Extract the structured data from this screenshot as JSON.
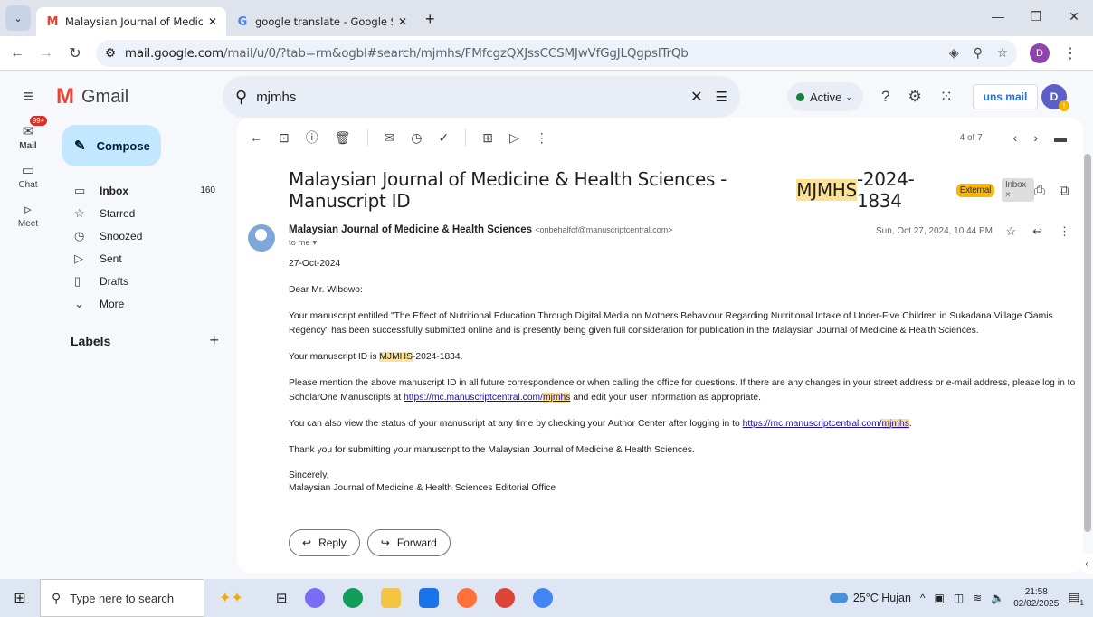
{
  "browser": {
    "tabs": [
      {
        "title": "Malaysian Journal of Medicine (",
        "icon": "gmail-icon",
        "active": true
      },
      {
        "title": "google translate - Google Searc",
        "icon": "google-icon",
        "active": false
      }
    ],
    "url_host": "mail.google.com",
    "url_path": "/mail/u/0/?tab=rm&ogbl#search/mjmhs/FMfcgzQXJssCCSMJwVfGgJLQgpslTrQb",
    "profile_initial": "D"
  },
  "gmail": {
    "logo_text": "Gmail",
    "search_value": "mjmhs",
    "status_label": "Active",
    "org_label": "uns mail",
    "user_initial": "D"
  },
  "rail": {
    "mail_label": "Mail",
    "mail_badge": "99+",
    "chat_label": "Chat",
    "meet_label": "Meet"
  },
  "sidebar": {
    "compose_label": "Compose",
    "items": [
      {
        "label": "Inbox",
        "count": "160",
        "icon": "inbox-icon"
      },
      {
        "label": "Starred",
        "count": "",
        "icon": "star-icon"
      },
      {
        "label": "Snoozed",
        "count": "",
        "icon": "clock-icon"
      },
      {
        "label": "Sent",
        "count": "",
        "icon": "send-icon"
      },
      {
        "label": "Drafts",
        "count": "",
        "icon": "draft-icon"
      },
      {
        "label": "More",
        "count": "",
        "icon": "chevron-down-icon"
      }
    ],
    "labels_heading": "Labels"
  },
  "message": {
    "pager": "4 of 7",
    "subject_before": "Malaysian Journal of Medicine & Health Sciences - Manuscript ID ",
    "subject_highlight": "MJMHS",
    "subject_after": "-2024-1834",
    "tag_external": "External",
    "tag_inbox": "Inbox ×",
    "sender_name": "Malaysian Journal of Medicine & Health Sciences",
    "sender_email": "<onbehalfof@manuscriptcentral.com>",
    "to_line": "to me ▾",
    "date": "Sun, Oct 27, 2024, 10:44 PM",
    "p_date": "27-Oct-2024",
    "p_greeting": "Dear Mr. Wibowo:",
    "p1": "Your manuscript entitled \"The Effect of Nutritional Education Through Digital Media on Mothers Behaviour Regarding Nutritional Intake of Under-Five Children in Sukadana Village Ciamis Regency\" has been successfully submitted online and is presently being given full consideration for publication in the Malaysian Journal of Medicine & Health Sciences.",
    "p2_before": "Your manuscript ID is ",
    "p2_highlight": "MJMHS",
    "p2_after": "-2024-1834.",
    "p3_before": "Please mention the above manuscript ID in all future correspondence or when calling the office for questions. If there are any changes in your street address or e-mail address, please log in to ScholarOne Manuscripts at ",
    "link_base": "https://mc.manuscriptcentral.com/",
    "link_hl": "mjmhs",
    "p3_after": " and edit your user information as appropriate.",
    "p4_before": "You can also view the status of your manuscript at any time by checking your Author Center after logging in to ",
    "p4_after": ".",
    "p5": "Thank you for submitting your manuscript to the Malaysian Journal of Medicine & Health Sciences.",
    "closing": "Sincerely,",
    "signature": "Malaysian Journal of Medicine & Health Sciences Editorial Office",
    "reply_label": "Reply",
    "forward_label": "Forward"
  },
  "taskbar": {
    "search_placeholder": "Type here to search",
    "weather": "25°C  Hujan",
    "time": "21:58",
    "date": "02/02/2025",
    "notif_count": "1"
  },
  "colors": {
    "accent": "#c2e7ff",
    "highlight": "#fde293",
    "external_tag": "#f9b700"
  }
}
